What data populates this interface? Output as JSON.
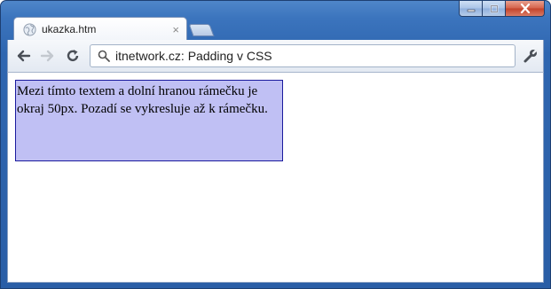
{
  "tab": {
    "title": "ukazka.htm",
    "close_glyph": "×",
    "favicon": "globe-icon"
  },
  "window_controls": {
    "minimize": "minimize-icon",
    "maximize": "maximize-icon",
    "close": "close-icon"
  },
  "toolbar": {
    "back_icon": "back-arrow-icon",
    "forward_icon": "forward-arrow-icon",
    "reload_icon": "reload-icon",
    "search_icon": "search-icon",
    "address": "itnetwork.cz: Padding v CSS",
    "wrench_icon": "wrench-icon"
  },
  "page": {
    "box_text": "Mezi tímto textem a dolní hranou rámečku je okraj 50px. Pozadí se vykresluje až k rámečku."
  },
  "colors": {
    "frame": "#3b74bd",
    "box_background": "#c0c0f4",
    "box_border": "#1a1a9e"
  }
}
